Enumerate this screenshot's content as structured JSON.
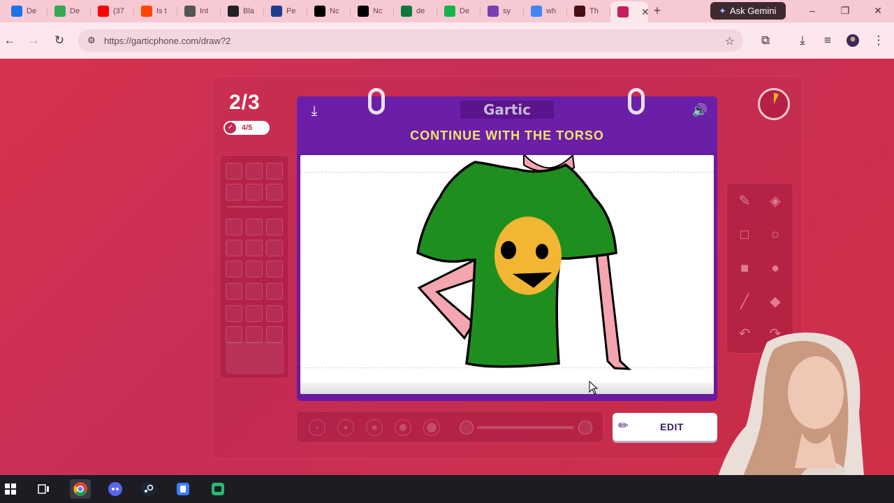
{
  "browser": {
    "tabs": [
      {
        "label": "De",
        "icon": "google-drive-icon",
        "color": "#1a73e8"
      },
      {
        "label": "De",
        "icon": "google-drive-icon",
        "color": "#34a853"
      },
      {
        "label": "(37",
        "icon": "youtube-icon",
        "color": "#ff0000"
      },
      {
        "label": "Is t",
        "icon": "reddit-icon",
        "color": "#ff4500"
      },
      {
        "label": "Int",
        "icon": "globe-icon",
        "color": "#555555"
      },
      {
        "label": "Bla",
        "icon": "wix-icon",
        "color": "#222222"
      },
      {
        "label": "Pe",
        "icon": "site-icon",
        "color": "#1f3d8f"
      },
      {
        "label": "Nc",
        "icon": "x-icon",
        "color": "#000000"
      },
      {
        "label": "Nc",
        "icon": "x-icon",
        "color": "#000000"
      },
      {
        "label": "de",
        "icon": "site-icon",
        "color": "#0b7a3b"
      },
      {
        "label": "De",
        "icon": "site-icon",
        "color": "#17b34a"
      },
      {
        "label": "sy",
        "icon": "peace-icon",
        "color": "#7b3fb0"
      },
      {
        "label": "wh",
        "icon": "google-icon",
        "color": "#4285f4"
      },
      {
        "label": "Th",
        "icon": "site-icon",
        "color": "#4a0f14"
      },
      {
        "label": "",
        "icon": "gartic-icon",
        "color": "#c51f5d"
      }
    ],
    "new_tab": "+",
    "gemini_label": "Ask Gemini",
    "url": "https://garticphone.com/draw?2"
  },
  "game": {
    "round": "2/3",
    "players_done": "4/5",
    "logo": "Gartic",
    "prompt": "CONTINUE WITH THE TORSO",
    "edit_label": "EDIT",
    "accent": "#6b1fa8",
    "prompt_color": "#f3e56a"
  },
  "drawing": {
    "shirt_color": "#1e8f1e",
    "face_color": "#f2b632",
    "skin_color": "#f4a5b0"
  },
  "taskbar": {
    "items": [
      "windows-start-icon",
      "task-view-icon",
      "chrome-icon",
      "discord-icon",
      "steam-icon",
      "app-icon",
      "game-icon"
    ]
  }
}
